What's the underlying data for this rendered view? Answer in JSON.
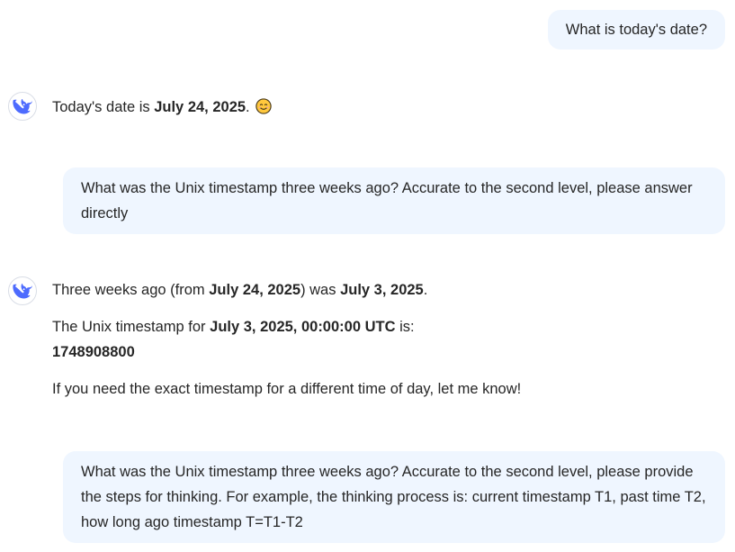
{
  "conversation": {
    "msg1_user": "What is today's date?",
    "msg2_assistant": {
      "prefix": "Today's date is ",
      "date_bold": "July 24, 2025",
      "suffix": ".",
      "emoji": "smiling-face-emoji"
    },
    "msg3_user": "What was the Unix timestamp three weeks ago? Accurate to the second level, please answer directly",
    "msg4_assistant": {
      "line1_prefix": "Three weeks ago (from ",
      "line1_from_date": "July 24, 2025",
      "line1_middle": ") was ",
      "line1_result_date": "July 3, 2025",
      "line1_suffix": ".",
      "line2_prefix": "The Unix timestamp for ",
      "line2_datetime": "July 3, 2025, 00:00:00 UTC",
      "line2_suffix": " is:",
      "timestamp": "1748908800",
      "line3": "If you need the exact timestamp for a different time of day, let me know!"
    },
    "msg5_user": "What was the Unix timestamp three weeks ago? Accurate to the second level, please provide the steps for thinking. For example, the thinking process is: current timestamp T1, past time T2, how long ago timestamp T=T1-T2"
  },
  "icons": {
    "assistant_avatar": "deepseek-whale-logo",
    "emoji": "smiling-face-emoji"
  },
  "colors": {
    "user_bubble_bg": "#eff6ff",
    "logo_blue": "#4d6bfe",
    "text": "#262626"
  }
}
